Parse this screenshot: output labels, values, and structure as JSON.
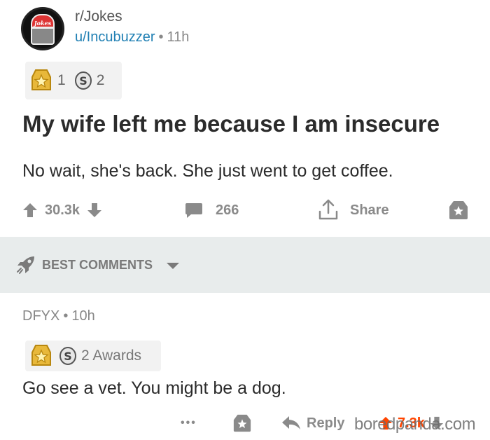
{
  "post": {
    "subreddit": "r/Jokes",
    "subreddit_avatar_label": "Jokes",
    "author": "u/Incubuzzer",
    "age": "11h",
    "awards": [
      {
        "icon": "gold-medal-icon",
        "count": "1"
      },
      {
        "icon": "silver-coin-icon",
        "count": "2"
      }
    ],
    "title": "My wife left me because I am insecure",
    "body": "No wait, she's back. She just went to get coffee.",
    "score": "30.3k",
    "comments": "266",
    "share_label": "Share"
  },
  "best_comments": {
    "label": "BEST COMMENTS"
  },
  "comment": {
    "author": "DFYX",
    "age": "10h",
    "awards_label": "2 Awards",
    "body": "Go see a vet. You might be a dog.",
    "more": "•••",
    "reply_label": "Reply",
    "score": "7.3k"
  },
  "watermark": "boredpanda.com",
  "colors": {
    "link_blue": "#1f7fb3",
    "icon_grey": "#8a8a8a",
    "upvote_orange": "#ff4500",
    "best_bar_bg": "#e8ecec"
  }
}
